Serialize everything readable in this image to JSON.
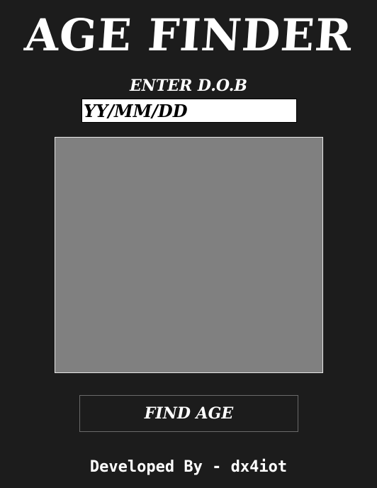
{
  "app": {
    "title": "AGE FINDER"
  },
  "form": {
    "dob_label": "ENTER D.O.B",
    "dob_placeholder": "YY/MM/DD",
    "dob_value": ""
  },
  "result": {
    "text": ""
  },
  "actions": {
    "find_age_label": "FIND AGE"
  },
  "footer": {
    "credit": "Developed By - dx4iot"
  },
  "colors": {
    "background": "#1c1c1c",
    "panel": "#808080",
    "input_background": "#ffffff",
    "text": "#ffffff"
  }
}
